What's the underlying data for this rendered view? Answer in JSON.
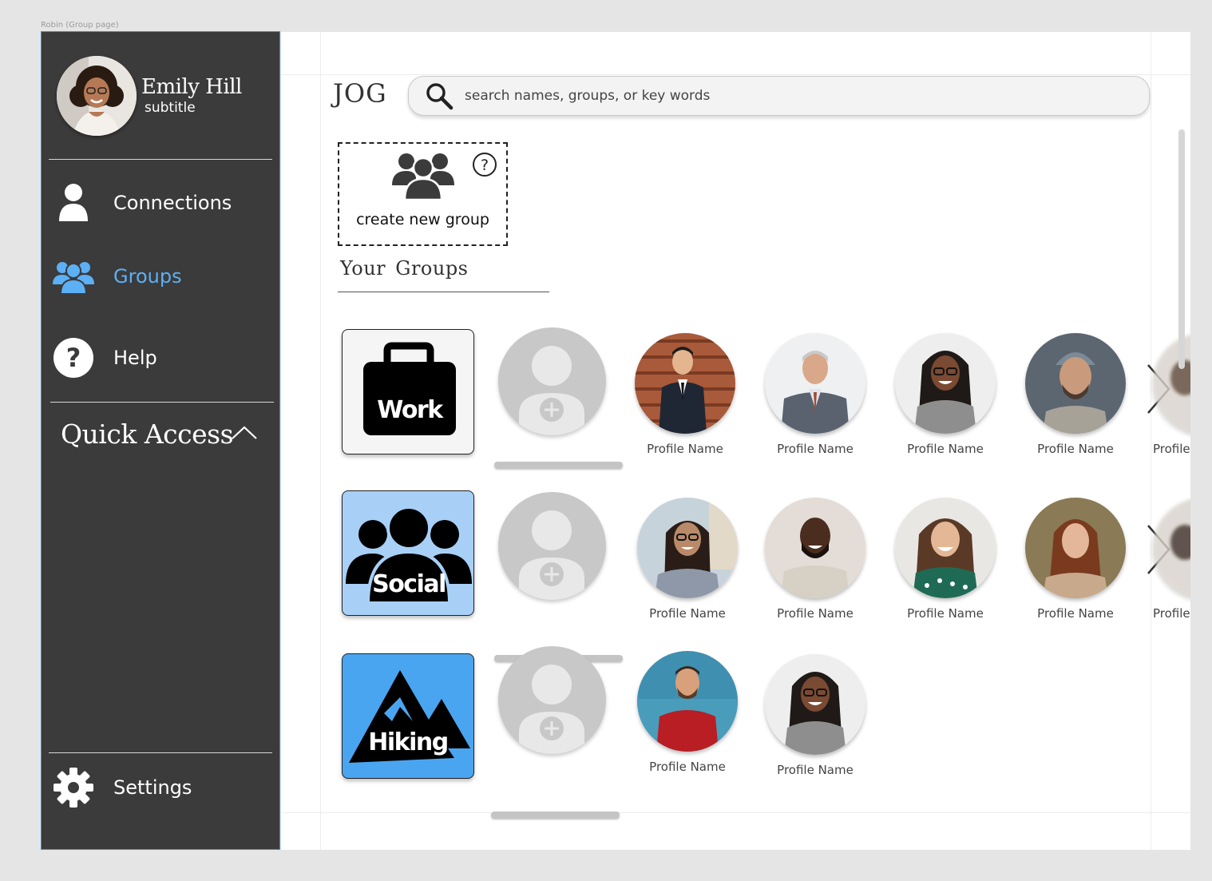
{
  "frame_label": "Robin (Group page)",
  "user": {
    "name": "Emily Hill",
    "subtitle": "subtitle"
  },
  "nav": {
    "connections": "Connections",
    "groups": "Groups",
    "help": "Help",
    "settings": "Settings",
    "active": "groups",
    "active_color": "#5cb0f5"
  },
  "quick_access": {
    "title": "Quick Access",
    "expanded": true
  },
  "header": {
    "logo": "JOG",
    "search_placeholder": "search names, groups, or key words"
  },
  "create_group": {
    "label": "create new group"
  },
  "section": {
    "title": "Your  Groups"
  },
  "groups": [
    {
      "name": "Work",
      "tile_color": "#f5f5f5",
      "icon": "briefcase-icon",
      "members": [
        "Profile Name",
        "Profile Name",
        "Profile Name",
        "Profile Name"
      ],
      "peek_label": "Profile Name",
      "has_more": true
    },
    {
      "name": "Social",
      "tile_color": "#a8d0f7",
      "icon": "people-icon",
      "members": [
        "Profile Name",
        "Profile Name",
        "Profile Name",
        "Profile Name"
      ],
      "peek_label": "Profile Name",
      "has_more": true
    },
    {
      "name": "Hiking",
      "tile_color": "#4aa5f0",
      "icon": "mountain-icon",
      "members": [
        "Profile Name",
        "Profile Name"
      ],
      "has_more": false
    }
  ],
  "colors": {
    "sidebar_bg": "#3b3b3b",
    "accent": "#5cb0f5",
    "canvas_bg": "#ffffff"
  }
}
